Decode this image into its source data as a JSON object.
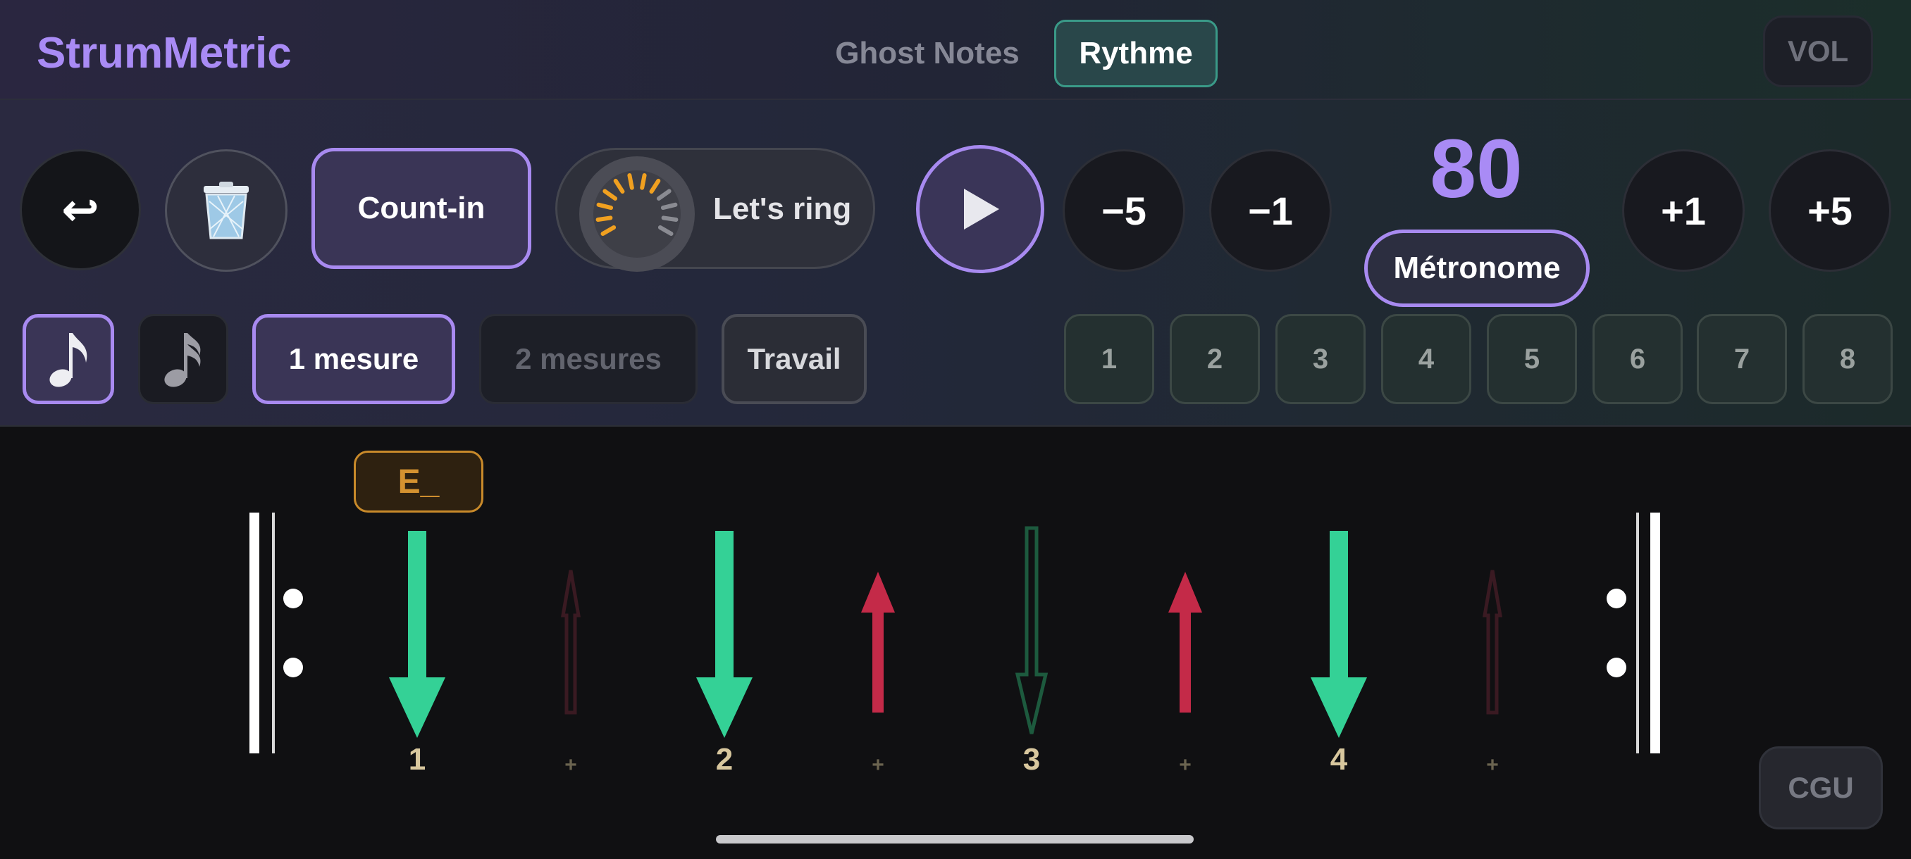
{
  "app": {
    "brand": "StrumMetric"
  },
  "header": {
    "tabs": [
      {
        "label": "Ghost Notes",
        "active": false
      },
      {
        "label": "Rythme",
        "active": true
      }
    ],
    "vol_label": "VOL"
  },
  "controls": {
    "undo_icon": "↩",
    "trash_icon": "trash-icon",
    "count_in_label": "Count-in",
    "lets_ring_label": "Let's ring",
    "play_icon": "play-icon",
    "tempo_minus5": "−5",
    "tempo_minus1": "−1",
    "tempo_plus1": "+1",
    "tempo_plus5": "+5",
    "bpm": "80",
    "metronome_label": "Métronome"
  },
  "row2": {
    "note_eighth_icon": "eighth-note-icon",
    "note_sixteenth_icon": "sixteenth-note-icon",
    "measure_1": "1 mesure",
    "measure_2": "2 mesures",
    "travail": "Travail",
    "pattern_numbers": [
      "1",
      "2",
      "3",
      "4",
      "5",
      "6",
      "7",
      "8"
    ]
  },
  "staff": {
    "chord": "E_",
    "beats": [
      "1",
      "2",
      "3",
      "4"
    ],
    "offbeat": "+",
    "strokes": [
      {
        "count": "1",
        "direction": "down",
        "state": "active"
      },
      {
        "count": "+",
        "direction": "up",
        "state": "muted"
      },
      {
        "count": "2",
        "direction": "down",
        "state": "active"
      },
      {
        "count": "+",
        "direction": "up",
        "state": "active"
      },
      {
        "count": "3",
        "direction": "down",
        "state": "ghost"
      },
      {
        "count": "+",
        "direction": "up",
        "state": "active"
      },
      {
        "count": "4",
        "direction": "down",
        "state": "active"
      },
      {
        "count": "+",
        "direction": "up",
        "state": "muted"
      }
    ]
  },
  "footer": {
    "cgu_label": "CGU"
  },
  "colors": {
    "accent": "#a88af0",
    "down_active": "#34d196",
    "up_active": "#c42a48",
    "up_muted": "#3a1a22",
    "down_ghost": "#1d5a3e",
    "chord": "#d49230"
  }
}
